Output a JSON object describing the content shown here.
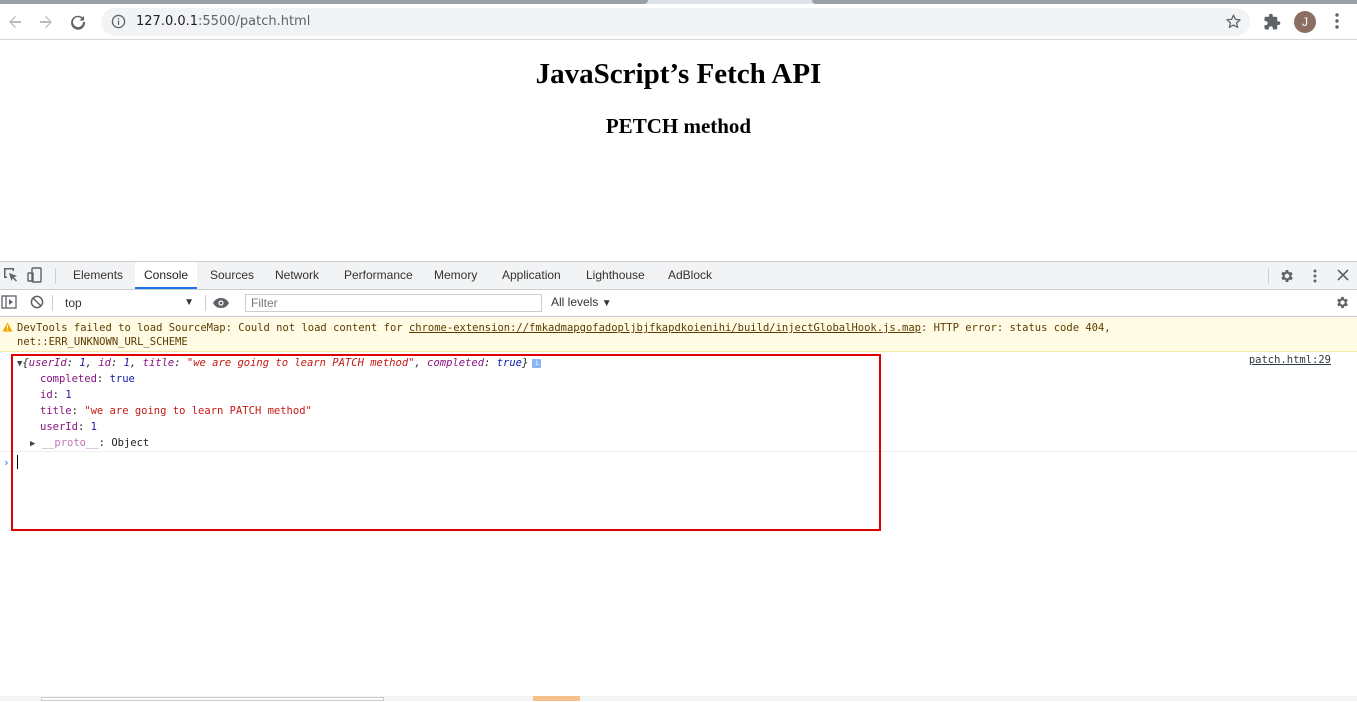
{
  "browser": {
    "url_host": "127.0.0.1",
    "url_path": ":5500/patch.html",
    "avatar_initial": "J",
    "icons": {
      "back": "arrow-left-icon",
      "forward": "arrow-right-icon",
      "reload": "reload-icon",
      "site_info": "info-circle-icon",
      "bookmark": "star-icon",
      "extensions": "puzzle-icon",
      "menu": "vertical-dots-icon"
    }
  },
  "page": {
    "heading": "JavaScript’s Fetch API",
    "subheading": "PETCH method"
  },
  "devtools": {
    "tabs": [
      {
        "label": "Elements"
      },
      {
        "label": "Console",
        "active": true
      },
      {
        "label": "Sources"
      },
      {
        "label": "Network"
      },
      {
        "label": "Performance"
      },
      {
        "label": "Memory"
      },
      {
        "label": "Application"
      },
      {
        "label": "Lighthouse"
      },
      {
        "label": "AdBlock"
      }
    ],
    "console": {
      "context": "top",
      "filter_placeholder": "Filter",
      "levels": "All levels",
      "warning": {
        "prefix": "DevTools failed to load SourceMap: Could not load content for ",
        "link": "chrome-extension://fmkadmapgofadopljbjfkapdkoienihi/build/injectGlobalHook.js.map",
        "suffix": ": HTTP error: status code 404,",
        "line2": "net::ERR_UNKNOWN_URL_SCHEME"
      },
      "log": {
        "source": "patch.html:29",
        "summary": {
          "userId_key": "userId",
          "userId_val": "1",
          "id_key": "id",
          "id_val": "1",
          "title_key": "title",
          "title_val": "\"we are going to learn PATCH method\"",
          "completed_key": "completed",
          "completed_val": "true"
        },
        "props": [
          {
            "key": "completed",
            "value": "true"
          },
          {
            "key": "id",
            "value": "1"
          },
          {
            "key": "title",
            "value": "\"we are going to learn PATCH method\""
          },
          {
            "key": "userId",
            "value": "1"
          }
        ],
        "proto_key": "__proto__",
        "proto_val": "Object"
      }
    }
  },
  "colors": {
    "highlight": "#e00000",
    "accent": "#1a73e8",
    "warning_bg": "#fffbe5"
  }
}
